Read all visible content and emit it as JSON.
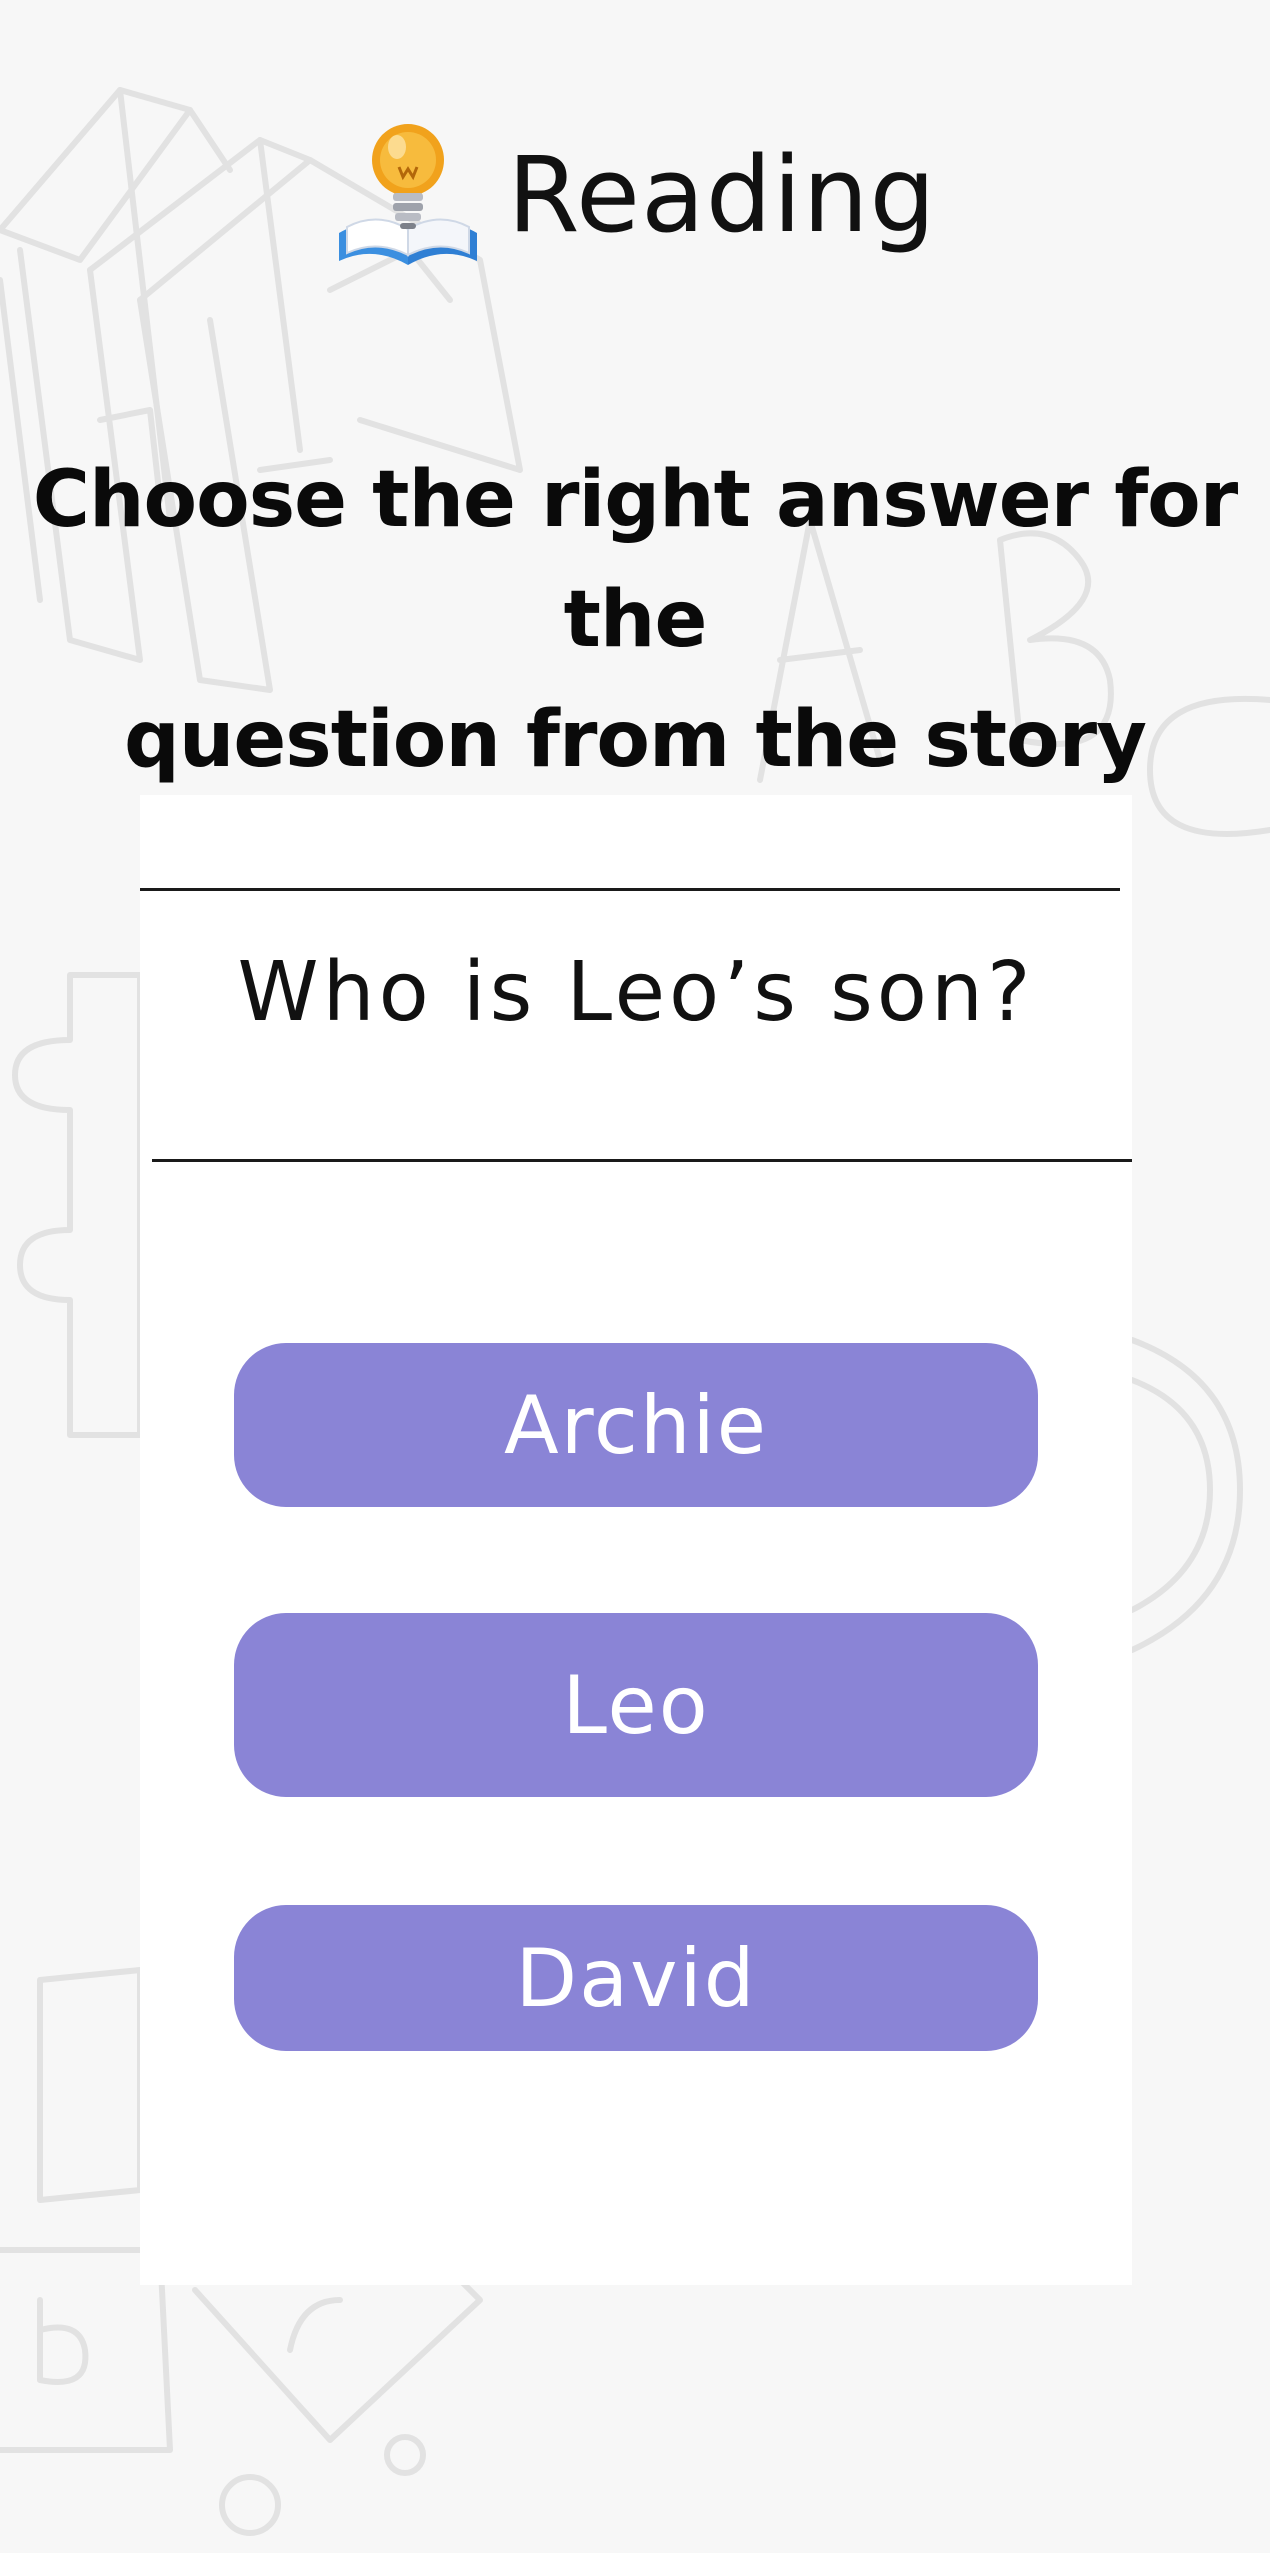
{
  "header": {
    "title": "Reading",
    "logo_icon": "lightbulb-book-icon"
  },
  "instruction": {
    "line1": "Choose the right answer for the",
    "line2": "question from the story"
  },
  "quiz": {
    "question": "Who is Leo’s son?",
    "answers": [
      {
        "label": "Archie"
      },
      {
        "label": "Leo"
      },
      {
        "label": "David"
      }
    ]
  },
  "colors": {
    "background": "#f7f7f7",
    "card": "#ffffff",
    "answer_button": "#8a84d6",
    "answer_text": "#ffffff",
    "text": "#111111"
  }
}
